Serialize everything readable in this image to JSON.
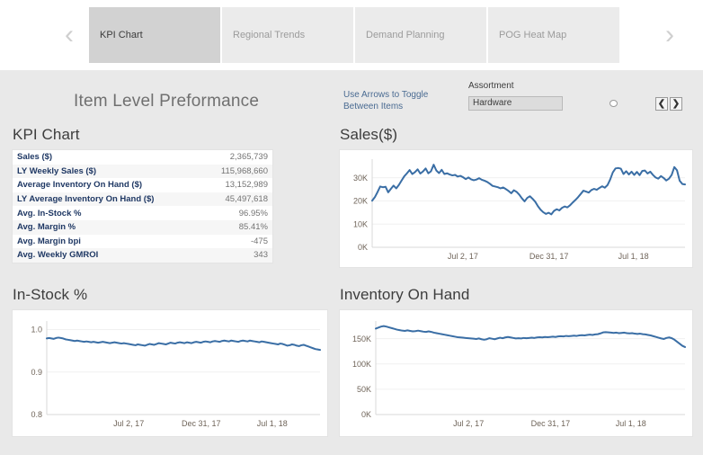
{
  "tabs": {
    "prev_icon": "‹",
    "next_icon": "›",
    "items": [
      {
        "label": "KPI Chart",
        "active": true
      },
      {
        "label": "Regional Trends",
        "active": false
      },
      {
        "label": "Demand Planning",
        "active": false
      },
      {
        "label": "POG Heat Map",
        "active": false
      }
    ]
  },
  "header": {
    "title": "Item Level Preformance",
    "toggle_note": "Use Arrows to Toggle Between Items",
    "assortment_label": "Assortment",
    "assortment_value": "Hardware",
    "assortment_placeholder": "Hardware",
    "prev_item_icon": "❮",
    "next_item_icon": "❯"
  },
  "kpi": {
    "title": "KPI Chart",
    "rows": [
      {
        "label": "Sales ($)",
        "value": "2,365,739"
      },
      {
        "label": "LY Weekly Sales ($)",
        "value": "115,968,660"
      },
      {
        "label": "Average Inventory On Hand ($)",
        "value": "13,152,989"
      },
      {
        "label": "LY Average Inventory On Hand ($)",
        "value": "45,497,618"
      },
      {
        "label": "Avg. In-Stock %",
        "value": "96.95%"
      },
      {
        "label": "Avg. Margin %",
        "value": "85.41%"
      },
      {
        "label": "Avg. Margin bpi",
        "value": "-475"
      },
      {
        "label": "Avg. Weekly GMROI",
        "value": "343"
      }
    ]
  },
  "colors": {
    "series": "#3a6ea5",
    "panel_bg": "#e9e9e9",
    "tab_active": "#d2d2d2",
    "tab_inactive": "#ebebeb",
    "kpi_label": "#1f3864",
    "kpi_value": "#737373"
  },
  "chart_data": [
    {
      "id": "sales",
      "type": "line",
      "title": "Sales($)",
      "xlabel": "",
      "ylabel": "",
      "ylim": [
        0,
        38000
      ],
      "yticks": [
        0,
        10000,
        20000,
        30000
      ],
      "yticklabels": [
        "0K",
        "10K",
        "20K",
        "30K"
      ],
      "xticklabels": [
        "Jul 2, 17",
        "Dec 31, 17",
        "Jul 1, 18"
      ],
      "xtick_positions": [
        0.29,
        0.565,
        0.835
      ],
      "grid": true,
      "legend": "none",
      "values": [
        20100,
        21600,
        23800,
        26200,
        25900,
        26100,
        23700,
        25200,
        26600,
        25400,
        26900,
        28800,
        30600,
        31900,
        33300,
        31600,
        32400,
        33600,
        31800,
        32700,
        34000,
        31900,
        32800,
        35600,
        33100,
        32000,
        33400,
        31600,
        31900,
        31400,
        31000,
        31200,
        30500,
        30800,
        30200,
        29400,
        30100,
        29300,
        28900,
        29200,
        29800,
        29100,
        28700,
        28200,
        27400,
        26500,
        26200,
        25900,
        25400,
        25800,
        25100,
        24300,
        23300,
        24600,
        23900,
        22700,
        21100,
        19800,
        21300,
        22000,
        20900,
        19600,
        17700,
        16200,
        15100,
        14400,
        14900,
        14200,
        15700,
        16400,
        15900,
        17000,
        17600,
        17200,
        18100,
        19300,
        20400,
        21600,
        23000,
        24400,
        24000,
        23600,
        24700,
        25200,
        24800,
        25600,
        26300,
        25700,
        26800,
        29200,
        32300,
        34000,
        34200,
        33900,
        31600,
        32800,
        31400,
        32600,
        31200,
        32500,
        31100,
        32900,
        33100,
        31800,
        32600,
        31200,
        30100,
        29600,
        30700,
        29900,
        28800,
        29600,
        31200,
        34600,
        33200,
        28700,
        27300,
        27100
      ]
    },
    {
      "id": "instock",
      "type": "line",
      "title": "In-Stock %",
      "xlabel": "",
      "ylabel": "",
      "ylim": [
        0.8,
        1.02
      ],
      "yticks": [
        0.8,
        0.9,
        1.0
      ],
      "yticklabels": [
        "0.8",
        "0.9",
        "1.0"
      ],
      "xticklabels": [
        "Jul 2, 17",
        "Dec 31, 17",
        "Jul 1, 18"
      ],
      "xtick_positions": [
        0.3,
        0.565,
        0.825
      ],
      "grid": true,
      "legend": "none",
      "values": [
        0.979,
        0.98,
        0.979,
        0.978,
        0.98,
        0.981,
        0.98,
        0.979,
        0.977,
        0.976,
        0.975,
        0.974,
        0.973,
        0.974,
        0.973,
        0.972,
        0.971,
        0.972,
        0.971,
        0.97,
        0.971,
        0.97,
        0.969,
        0.97,
        0.971,
        0.97,
        0.969,
        0.968,
        0.969,
        0.97,
        0.969,
        0.968,
        0.967,
        0.968,
        0.967,
        0.966,
        0.965,
        0.964,
        0.963,
        0.965,
        0.964,
        0.963,
        0.962,
        0.964,
        0.966,
        0.965,
        0.964,
        0.966,
        0.968,
        0.967,
        0.966,
        0.965,
        0.967,
        0.969,
        0.968,
        0.967,
        0.969,
        0.97,
        0.969,
        0.968,
        0.97,
        0.969,
        0.968,
        0.97,
        0.971,
        0.97,
        0.969,
        0.971,
        0.972,
        0.971,
        0.97,
        0.972,
        0.973,
        0.972,
        0.971,
        0.973,
        0.974,
        0.973,
        0.972,
        0.974,
        0.973,
        0.972,
        0.971,
        0.973,
        0.974,
        0.973,
        0.972,
        0.974,
        0.973,
        0.972,
        0.971,
        0.97,
        0.972,
        0.971,
        0.97,
        0.969,
        0.968,
        0.967,
        0.966,
        0.965,
        0.967,
        0.966,
        0.964,
        0.962,
        0.963,
        0.965,
        0.964,
        0.962,
        0.961,
        0.963,
        0.964,
        0.962,
        0.96,
        0.958,
        0.956,
        0.954,
        0.953,
        0.952
      ]
    },
    {
      "id": "inventory",
      "type": "line",
      "title": "Inventory On Hand",
      "xlabel": "",
      "ylabel": "",
      "ylim": [
        0,
        185000
      ],
      "yticks": [
        0,
        50000,
        100000,
        150000
      ],
      "yticklabels": [
        "0K",
        "50K",
        "100K",
        "150K"
      ],
      "xticklabels": [
        "Jul 2, 17",
        "Dec 31, 17",
        "Jul 1, 18"
      ],
      "xtick_positions": [
        0.3,
        0.565,
        0.825
      ],
      "grid": true,
      "legend": "none",
      "values": [
        170000,
        172000,
        174000,
        175000,
        174000,
        172500,
        171000,
        169500,
        168000,
        167000,
        166000,
        165500,
        166500,
        165500,
        164500,
        165000,
        166000,
        165000,
        164000,
        163500,
        164500,
        163500,
        162000,
        161000,
        160000,
        159000,
        158000,
        157000,
        156000,
        155000,
        154000,
        153000,
        152500,
        152000,
        151500,
        151000,
        150500,
        150000,
        149500,
        150500,
        149000,
        148000,
        149000,
        151000,
        150000,
        149000,
        150500,
        152000,
        151000,
        152500,
        153500,
        152500,
        151500,
        150500,
        151000,
        150500,
        151500,
        151000,
        151500,
        152000,
        151500,
        152500,
        153000,
        152500,
        153500,
        153000,
        153500,
        154000,
        153500,
        154500,
        155000,
        154500,
        155500,
        155000,
        155500,
        156000,
        155500,
        156500,
        157000,
        156500,
        157500,
        158000,
        157500,
        158500,
        159000,
        160500,
        162500,
        163000,
        162500,
        162000,
        161500,
        162000,
        161000,
        161500,
        162000,
        161000,
        160500,
        161000,
        160000,
        159500,
        160000,
        159000,
        158500,
        157500,
        156500,
        155000,
        153500,
        152000,
        150500,
        149500,
        151500,
        152500,
        151000,
        148000,
        144000,
        140000,
        136000,
        133500
      ]
    }
  ]
}
